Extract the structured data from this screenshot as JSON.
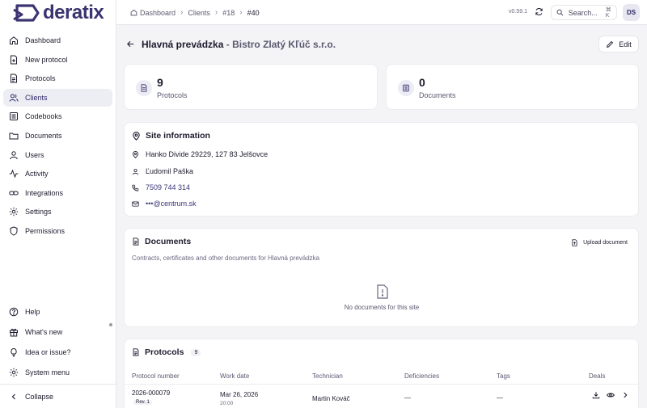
{
  "app": {
    "logo_text": "deratix",
    "version": "v0.59.1"
  },
  "breadcrumb": {
    "items": [
      "Dashboard",
      "Clients",
      "#18",
      "#40"
    ]
  },
  "search": {
    "label": "Search...",
    "shortcut": "⌘ K"
  },
  "user": {
    "initials": "DS"
  },
  "sidebar": {
    "items": [
      {
        "label": "Dashboard",
        "icon": "home-icon"
      },
      {
        "label": "New protocol",
        "icon": "file-plus-icon"
      },
      {
        "label": "Protocols",
        "icon": "file-text-icon"
      },
      {
        "label": "Clients",
        "icon": "users-icon",
        "active": true
      },
      {
        "label": "Codebooks",
        "icon": "list-icon"
      },
      {
        "label": "Documents",
        "icon": "folder-icon"
      },
      {
        "label": "Users",
        "icon": "user-icon"
      },
      {
        "label": "Activity",
        "icon": "activity-icon"
      },
      {
        "label": "Integrations",
        "icon": "link-icon"
      },
      {
        "label": "Settings",
        "icon": "gear-icon"
      },
      {
        "label": "Permissions",
        "icon": "shield-icon"
      }
    ],
    "bottom": [
      {
        "label": "Help",
        "icon": "help-icon"
      },
      {
        "label": "What's new",
        "icon": "gift-icon"
      },
      {
        "label": "Idea or issue?",
        "icon": "lightbulb-icon"
      },
      {
        "label": "System menu",
        "icon": "gear-icon"
      }
    ],
    "collapse_label": "Collapse"
  },
  "page": {
    "title": "Hlavná prevádzka",
    "title_sep": " - ",
    "subtitle": "Bistro Zlatý Kľúč s.r.o.",
    "edit_label": "Edit"
  },
  "stats": [
    {
      "value": "9",
      "label": "Protocols"
    },
    {
      "value": "0",
      "label": "Documents"
    }
  ],
  "site_info": {
    "title": "Site information",
    "address": "Hanko Divide 29229, 127 83 Jelšovce",
    "contact": "Ľudomil Paška",
    "phone": "7509 744 314",
    "email": "•••@centrum.sk"
  },
  "documents": {
    "title": "Documents",
    "subtitle": "Contracts, certificates and other documents for Hlavná prevádzka",
    "upload_label": "Upload document",
    "empty_text": "No documents for this site"
  },
  "protocols": {
    "title": "Protocols",
    "count": "9",
    "columns": [
      "Protocol number",
      "Work date",
      "Technician",
      "Deficiencies",
      "Tags",
      "Deals"
    ],
    "rows": [
      {
        "number": "2026-000079",
        "rev": "Rev. 1",
        "date": "Mar 26, 2026",
        "time": "20:00",
        "technician": "Martin Kováč",
        "deficiencies": "—",
        "tags": "—"
      }
    ]
  },
  "colors": {
    "accent": "#3b3470",
    "active_bg": "#ededf4"
  }
}
